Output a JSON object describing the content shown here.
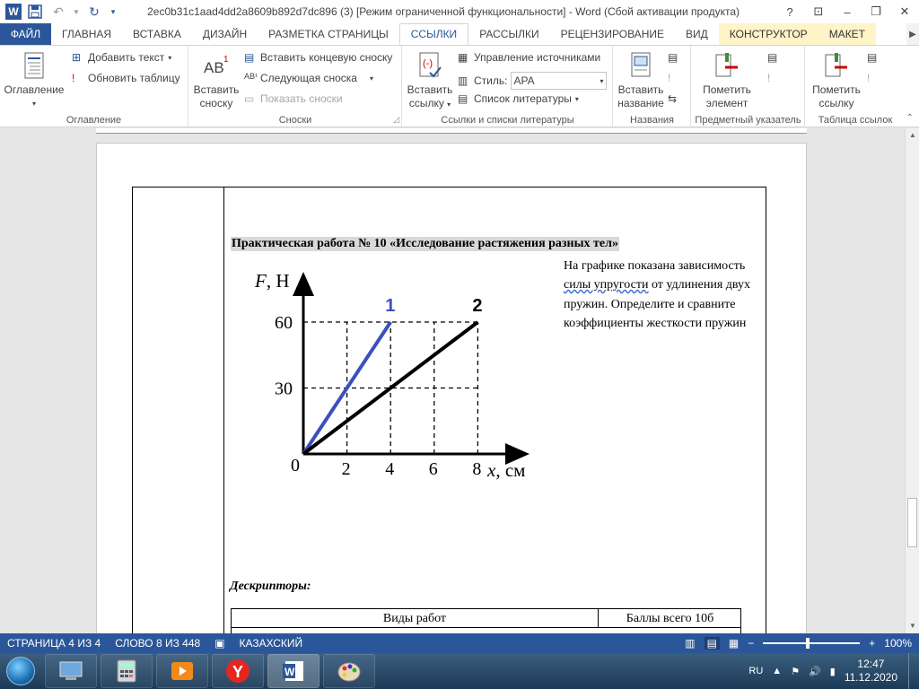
{
  "title_bar": {
    "title": "2ec0b31c1aad4dd2a8609b892d7dc896 (3) [Режим ограниченной функциональности] - Word (Сбой активации продукта)",
    "help": "?",
    "ribbon_display": "⊡",
    "minimize": "–",
    "restore": "❐",
    "close": "✕"
  },
  "ribbon_tabs": [
    "ФАЙЛ",
    "ГЛАВНАЯ",
    "ВСТАВКА",
    "ДИЗАЙН",
    "РАЗМЕТКА СТРАНИЦЫ",
    "ССЫЛКИ",
    "РАССЫЛКИ",
    "РЕЦЕНЗИРОВАНИЕ",
    "ВИД",
    "КОНСТРУКТОР",
    "МАКЕТ"
  ],
  "active_tab": "ССЫЛКИ",
  "ribbon": {
    "toc": {
      "big": "Оглавление",
      "add_text": "Добавить текст",
      "update_table": "Обновить таблицу",
      "label": "Оглавление"
    },
    "footnotes": {
      "insert_footnote_1": "Вставить",
      "insert_footnote_2": "сноску",
      "insert_endnote": "Вставить концевую сноску",
      "next_footnote": "Следующая сноска",
      "show_notes": "Показать сноски",
      "label": "Сноски"
    },
    "citations": {
      "insert_citation_1": "Вставить",
      "insert_citation_2": "ссылку",
      "manage_sources": "Управление источниками",
      "style_label": "Стиль:",
      "style_value": "APA",
      "bibliography": "Список литературы",
      "label": "Ссылки и списки литературы"
    },
    "captions": {
      "insert_caption_1": "Вставить",
      "insert_caption_2": "название",
      "label": "Названия"
    },
    "index": {
      "mark_entry_1": "Пометить",
      "mark_entry_2": "элемент",
      "label": "Предметный указатель"
    },
    "toa": {
      "mark_citation_1": "Пометить",
      "mark_citation_2": "ссылку",
      "label": "Таблица ссылок"
    }
  },
  "document": {
    "heading": "Практическая работа № 10 «Исследование растяжения разных тел»",
    "desc_part1": "На графике показана зависимость ",
    "desc_squiggle": "силы  упругости",
    "desc_part2": " от удлинения двух пружин. Определите и сравните коэффициенты жесткости пружин",
    "descriptors": "Дескрипторы:",
    "table_col1": "Виды работ",
    "table_col2": "Баллы всего 10б"
  },
  "chart_data": {
    "type": "line",
    "ylabel_var": "F",
    "ylabel_unit": ", Н",
    "xlabel_var": "x",
    "xlabel_unit": ", см",
    "origin_label": "0",
    "x_ticks": [
      "2",
      "4",
      "6",
      "8"
    ],
    "y_ticks": [
      "30",
      "60"
    ],
    "xlim": [
      0,
      10
    ],
    "ylim": [
      0,
      80
    ],
    "grid": "dashed",
    "series": [
      {
        "name": "1",
        "color": "#3c4fc0",
        "x": [
          0,
          4
        ],
        "y": [
          0,
          60
        ]
      },
      {
        "name": "2",
        "color": "#000000",
        "x": [
          0,
          8
        ],
        "y": [
          0,
          60
        ]
      }
    ]
  },
  "status_bar": {
    "page": "СТРАНИЦА 4 ИЗ 4",
    "words": "СЛОВО 8 ИЗ 448",
    "language": "КАЗАХСКИЙ",
    "zoom": "100%",
    "zoom_out": "−",
    "zoom_in": "+"
  },
  "taskbar": {
    "lang": "RU",
    "time": "12:47",
    "date": "11.12.2020"
  }
}
